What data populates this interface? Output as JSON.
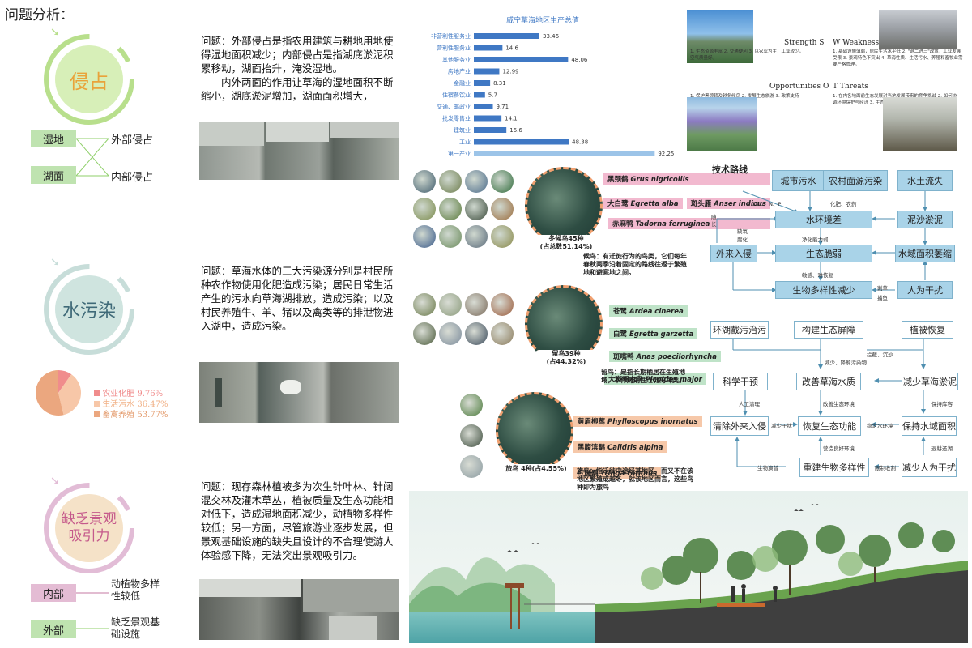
{
  "page_title": "问题分析：",
  "sections": [
    {
      "circle_label": "侵占",
      "problem": "问题：外部侵占是指农用建筑与耕地用地使得湿地面积减少；内部侵占是指湖底淤泥积累移动，湖面抬升，淹没湿地。",
      "problem2": "内外两面的作用让草海的湿地面积不断缩小，湖底淤泥增加，湖面面积增大，",
      "left_tags": [
        "湿地",
        "湖面"
      ],
      "right_tags": [
        "外部侵占",
        "内部侵占"
      ]
    },
    {
      "circle_label": "水污染",
      "problem": "问题：草海水体的三大污染源分别是村民所种农作物使用化肥造成污染；居民日常生活产生的污水向草海湖排放，造成污染；以及村民养殖牛、羊、猪以及禽类等的排泄物进入湖中，造成污染。",
      "pie": [
        {
          "label": "农业化肥",
          "value": "9.76%",
          "pct": 9.76,
          "color": "#f08c8c"
        },
        {
          "label": "生活污水",
          "value": "36.47%",
          "pct": 36.47,
          "color": "#f7c7a8"
        },
        {
          "label": "畜禽养殖",
          "value": "53.77%",
          "pct": 53.77,
          "color": "#eba77f"
        }
      ]
    },
    {
      "circle_label_1": "缺乏景观",
      "circle_label_2": "吸引力",
      "problem": "问题：现存森林植被多为次生针叶林、针阔混交林及灌木草丛，植被质量及生态功能相对低下，造成湿地面积减少，动植物多样性较低；另一方面，尽管旅游业逐步发展，但景观基础设施的缺失且设计的不合理使游人体验感下降，无法突出景观吸引力。",
      "left_tags": [
        "内部",
        "外部"
      ],
      "right_tag_1a": "动植物多样",
      "right_tag_1b": "性较低",
      "right_tag_2a": "缺乏景观基",
      "right_tag_2b": "础设施"
    }
  ],
  "chart_data": {
    "type": "bar",
    "title": "威宁草海地区生产总值",
    "categories": [
      "非营利性服务业",
      "营利性服务业",
      "其他服务业",
      "房地产业",
      "金融业",
      "住宿餐饮业",
      "交通、邮政业",
      "批发零售业",
      "建筑业",
      "工业",
      "第一产业"
    ],
    "values": [
      33.46,
      14.6,
      48.06,
      12.99,
      8.31,
      5.7,
      9.71,
      14.1,
      16.6,
      48.38,
      92.25
    ],
    "value_labels": [
      "33.46",
      "14.6",
      "48.06",
      "12.99",
      "8.31",
      "5.7",
      "9.71",
      "14.1",
      "16.6",
      "48.38",
      "92.25"
    ],
    "colors": [
      "#3f78c4",
      "#3f78c4",
      "#3f78c4",
      "#3f78c4",
      "#3f78c4",
      "#3f78c4",
      "#3f78c4",
      "#3f78c4",
      "#3f78c4",
      "#3f78c4",
      "#9cc4e8"
    ],
    "xlim": [
      0,
      95
    ]
  },
  "birds": {
    "group1": {
      "circle_text_1": "冬候鸟45种",
      "circle_text_2": "(占总数51.14%)",
      "species": [
        {
          "cn": "黑颈鹤",
          "latin": "Grus nigricollis"
        },
        {
          "cn": "大白鹭",
          "latin": "Egretta alba"
        },
        {
          "cn": "斑头雁",
          "latin": "Anser indicus"
        },
        {
          "cn": "赤麻鸭",
          "latin": "Tadorna ferruginea"
        }
      ],
      "note_title": "候鸟：",
      "note": "有迁徙行为的鸟类，它们每年春秋两季沿着固定的路线往返于繁殖地和避寒地之间。"
    },
    "group2": {
      "circle_text_1": "留鸟39种",
      "circle_text_2": "(占44.32%)",
      "species": [
        {
          "cn": "苍鹭",
          "latin": "Ardea cinerea"
        },
        {
          "cn": "白鹭",
          "latin": "Egretta garzetta"
        },
        {
          "cn": "斑嘴鸭",
          "latin": "Anas poecilorhyncha"
        },
        {
          "cn": "大斑啄木鸟",
          "latin": "Picoides major"
        }
      ],
      "note_title": "留鸟：",
      "note": "是指长期栖居在生殖地域，不作周期性迁徙的鸟类。"
    },
    "group3": {
      "circle_text": "旅鸟 4种(占4.55%)",
      "species": [
        {
          "cn": "黄眉柳莺",
          "latin": "Phylloscopus inornatus"
        },
        {
          "cn": "黑腹滨鹬",
          "latin": "Calidris alpina"
        },
        {
          "cn": "红脚鹬",
          "latin": "Tringa totanus"
        }
      ],
      "note_title": "旅鸟：",
      "note": "指迁徙中途经某地区，而又不在该地区繁殖或越冬，就该地区而言，这些鸟种即为旅鸟"
    }
  },
  "swot": {
    "s_title": "Strength S",
    "w_title": "W Weakness",
    "o_title": "Opportunities O",
    "t_title": "T Threats",
    "s_text": "1. 生态资源丰富 2. 交通便利 3. 以农业为主，工业较少，空气质量好。",
    "w_text": "1. 基础设施薄弱，居民生活水平低 2. \"退二进三\"政策，工业发展受限 3. 景观特色不突出 4. 草海性质、生活污水、养殖和畜牧业需要严格管理。",
    "o_text": "1. 保护黑颈鹤及越冬候鸟 2. 发展生态旅游 3. 政策支持 4. 需求和发展大众的旅游",
    "t_text": "1. 在内各地面前生态发展对当地发展带来的竞争挑战 2. 如何协调环境保护与经济 3. 生态修复与经济发展之间的矛盾"
  },
  "tech": {
    "title": "技术路线",
    "top": [
      "城市污水",
      "农村面源污染",
      "水土流失"
    ],
    "mid": [
      "水环境差",
      "泥沙淤泥",
      "外来入侵",
      "生态脆弱",
      "水域面积萎缩",
      "生物多样性减少",
      "人为干扰"
    ],
    "small": [
      "COD、N、P",
      "化肥、农药",
      "随长",
      "缺氧",
      "腐化",
      "净化能力弱",
      "敏感、难恢复",
      "割草",
      "捕鱼"
    ],
    "bottom": [
      "环湖截污治污",
      "构建生态屏障",
      "植被恢复",
      "科学干预",
      "改善草海水质",
      "减少草海淤泥",
      "清除外来入侵",
      "恢复生态功能",
      "保持水域面积",
      "重建生物多样性",
      "减少人为干扰"
    ],
    "bottom_small": [
      "减少、降解污染物",
      "拦截、沉沙",
      "人工清理",
      "改善生态环境",
      "保持库容",
      "减少干扰",
      "稳定水环境",
      "营造良好环境",
      "退耕还湖",
      "生物演替",
      "限制收割"
    ]
  }
}
